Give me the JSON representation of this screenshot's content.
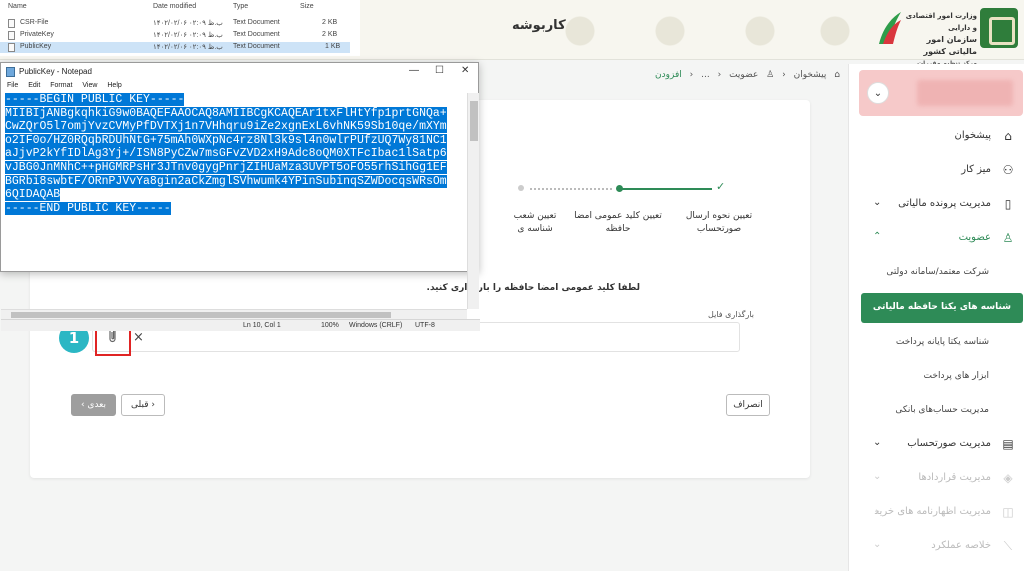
{
  "app": {
    "header_title": "کاربوشه"
  },
  "logo": {
    "line1": "وزارت امور اقتصادی و دارایی",
    "line2": "سازمان امور مالیاتی کشور",
    "line3": "مرکز تنظیم مقررات"
  },
  "breadcrumb": {
    "items": [
      "پیشخوان",
      "عضویت",
      "...",
      "افزودن"
    ]
  },
  "sidebar": {
    "items": [
      {
        "label": "پیشخوان"
      },
      {
        "label": "میز کار"
      },
      {
        "label": "مدیریت پرونده مالیاتی"
      },
      {
        "label": "عضویت"
      },
      {
        "label": "مدیریت صورتحساب"
      },
      {
        "label": "مدیریت قراردادها"
      },
      {
        "label": "مدیریت اظهارنامه های خرید"
      },
      {
        "label": "خلاصه عملکرد"
      }
    ],
    "subitems": [
      {
        "label": "شرکت معتمد/سامانه دولتی"
      },
      {
        "label": "شناسه های یکتا حافظه مالیاتی"
      },
      {
        "label": "شناسه یکتا پایانه پرداخت"
      },
      {
        "label": "ابزار های پرداخت"
      },
      {
        "label": "مدیریت حساب‌های بانکی"
      }
    ]
  },
  "stepper": {
    "steps": [
      {
        "label": "تعیین نحوه ارسال صورتحساب"
      },
      {
        "label": "تعیین کلید عمومی امضا حافظه"
      },
      {
        "label": "تعیین شعب شناسه ی"
      }
    ]
  },
  "form": {
    "instruction": "لطفا کلید عمومی امضا حافظه را بارگذاری کنید.",
    "upload_label": "بارگذاری فایل",
    "annotation_number": "1",
    "remove_symbol": "×"
  },
  "buttons": {
    "next": "بعدی ›",
    "prev": "‹ قبلی",
    "cancel": "انصراف"
  },
  "explorer": {
    "columns": [
      "Name",
      "Date modified",
      "Type",
      "Size"
    ],
    "rows": [
      {
        "name": "CSR-File",
        "date": "۱۴۰۲/۰۲/۰۶ ب.ظ ۰۲:۰۹",
        "type": "Text Document",
        "size": "2 KB"
      },
      {
        "name": "PrivateKey",
        "date": "۱۴۰۲/۰۲/۰۶ ب.ظ ۰۲:۰۹",
        "type": "Text Document",
        "size": "2 KB"
      },
      {
        "name": "PublicKey",
        "date": "۱۴۰۲/۰۲/۰۶ ب.ظ ۰۲:۰۹",
        "type": "Text Document",
        "size": "1 KB"
      }
    ]
  },
  "notepad": {
    "title": "PublicKey - Notepad",
    "menu": [
      "File",
      "Edit",
      "Format",
      "View",
      "Help"
    ],
    "window_controls": [
      "—",
      "☐",
      "✕"
    ],
    "lines": [
      "-----BEGIN PUBLIC KEY-----",
      "MIIBIjANBgkqhkiG9w0BAQEFAAOCAQ8AMIIBCgKCAQEAr1txFlHtYfp1prtGNQa+",
      "CwZQrO5l7omjYvzCVMyPfDVTXj1n7VHhqru9iZe2xgnExL6vhNK59Sb10qe/mXYm",
      "o2IF0o/HZ0RQqbRDUhNtG+75mAh0WXpNc4rz8Nl3k9sl4n0wlrPUfzUQ7Wy81NC1",
      "aJjvP2kYfIDlAg3Yj+/ISN8PyCZw7msGFvZVD2xH9Adc8oQM0XTFcIbac1lSatp6",
      "vJBG0JnMNhC++pHGMRPsHr3JTnv0gygPnrjZIHUaMza3UVPT5oFO55rhSihGg1EF",
      "BGRbi8swbtF/ORnPJVvYa8gin2aCkZmglSVhwumk4YPinSubinqSZWDocqsWRsOm",
      "6QIDAQAB",
      "-----END PUBLIC KEY-----"
    ],
    "status": {
      "position": "Ln 10, Col 1",
      "zoom": "100%",
      "line_ending": "Windows (CRLF)",
      "encoding": "UTF-8"
    }
  },
  "colors": {
    "accent": "#2e8b57",
    "annotation_badge": "#2bb7c4",
    "highlight_box": "#e02424",
    "selection": "#0078d7"
  }
}
